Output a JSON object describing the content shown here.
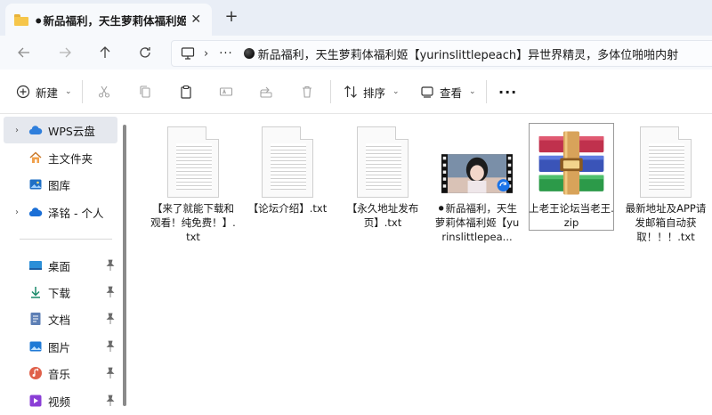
{
  "tab": {
    "title": "⚫新品福利，天生萝莉体福利姬",
    "close": "✕",
    "new_tab": "+"
  },
  "address": {
    "separator": "›",
    "dots": "···",
    "path": "新品福利，天生萝莉体福利姬【yurinslittlepeach】异世界精灵，多体位啪啪内射"
  },
  "toolbar": {
    "new_label": "新建",
    "sort_label": "排序",
    "view_label": "查看",
    "more": "···"
  },
  "sidebar": {
    "items": [
      {
        "label": "WPS云盘",
        "chevron": "›"
      },
      {
        "label": "主文件夹"
      },
      {
        "label": "图库"
      },
      {
        "label": "泽铭 - 个人",
        "chevron": "›"
      }
    ],
    "quick_access": [
      {
        "label": "桌面"
      },
      {
        "label": "下载"
      },
      {
        "label": "文档"
      },
      {
        "label": "图片"
      },
      {
        "label": "音乐"
      },
      {
        "label": "视频"
      }
    ]
  },
  "files": [
    {
      "name": "【来了就能下载和观看！纯免费！】.txt",
      "type": "txt"
    },
    {
      "name": "【论坛介绍】.txt",
      "type": "txt"
    },
    {
      "name": "【永久地址发布页】.txt",
      "type": "txt"
    },
    {
      "name": "⚫新品福利，天生萝莉体福利姬【yurinslittlepea...",
      "type": "video"
    },
    {
      "name": "上老王论坛当老王.zip",
      "type": "zip"
    },
    {
      "name": "最新地址及APP请发邮箱自动获取！！！.txt",
      "type": "txt"
    }
  ],
  "colors": {
    "tabstrip_bg": "#e9eef6",
    "selection_bg": "#e5e8ee",
    "accent": "#1a73e8"
  }
}
